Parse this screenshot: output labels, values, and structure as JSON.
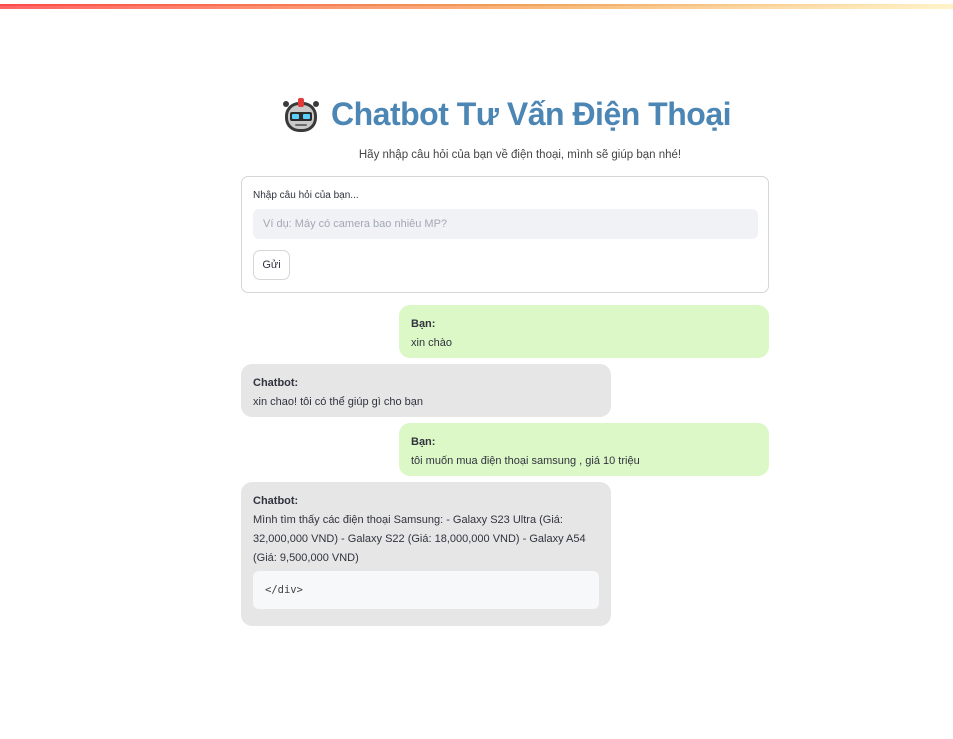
{
  "header": {
    "title": "Chatbot Tư Vấn Điện Thoại",
    "icon": "robot-icon",
    "subtitle": "Hãy nhập câu hỏi của bạn về điện thoại, mình sẽ giúp bạn nhé!"
  },
  "form": {
    "label": "Nhập câu hỏi của bạn...",
    "placeholder": "Ví dụ: Máy có camera bao nhiêu MP?",
    "value": "",
    "send_label": "Gửi"
  },
  "messages": [
    {
      "role": "user",
      "sender": "Bạn:",
      "text": "xin chào"
    },
    {
      "role": "bot",
      "sender": "Chatbot:",
      "text": "xin chao! tôi có thể giúp gì cho bạn"
    },
    {
      "role": "user",
      "sender": "Bạn:",
      "text": "tôi muốn mua điện thoại samsung , giá 10 triệu"
    },
    {
      "role": "bot",
      "sender": "Chatbot:",
      "text": "Mình tìm thấy các điện thoại Samsung: - Galaxy S23 Ultra (Giá: 32,000,000 VND) - Galaxy S22 (Giá: 18,000,000 VND) - Galaxy A54 (Giá: 9,500,000 VND)",
      "code": "</div>"
    }
  ],
  "colors": {
    "title": "#4b86b4",
    "user_bubble": "#dcf8c6",
    "bot_bubble": "#e6e6e6",
    "accent_gradient_start": "#ff4b4b",
    "accent_gradient_end": "#fff1c1"
  }
}
